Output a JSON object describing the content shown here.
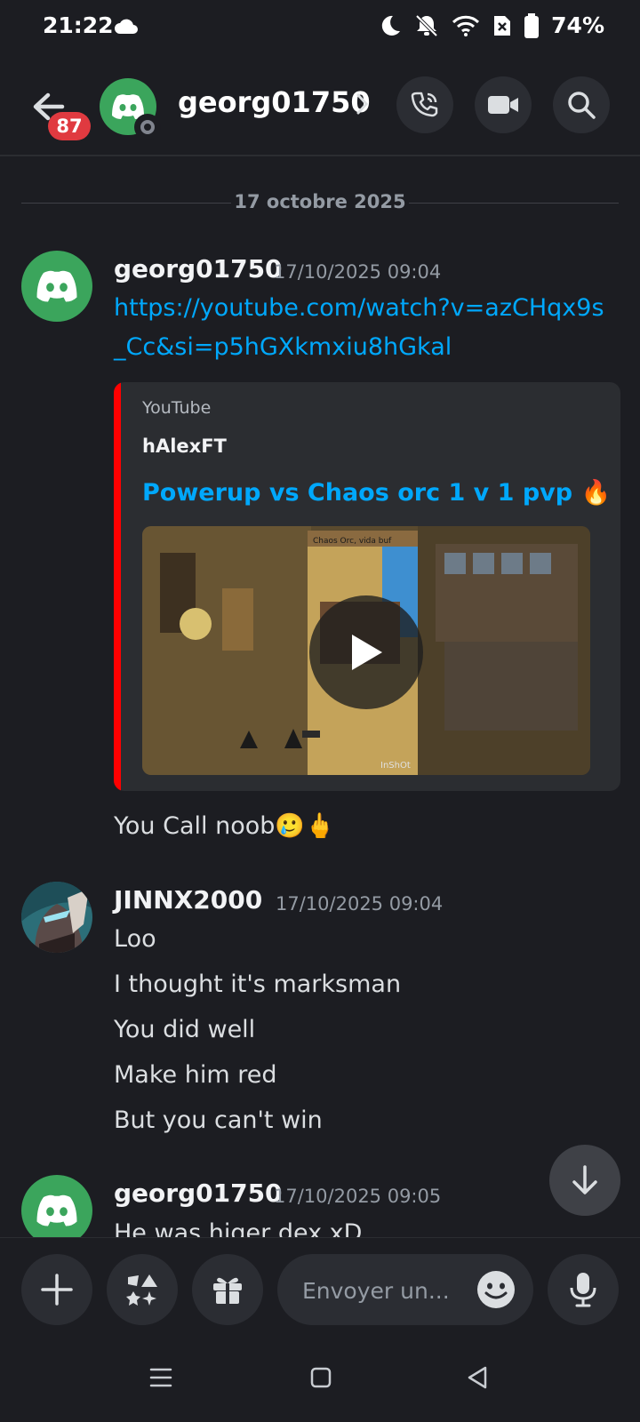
{
  "status_bar": {
    "time": "21:22",
    "battery": "74%"
  },
  "header": {
    "unread_count": "87",
    "username": "georg01750",
    "icons": [
      "back-arrow-icon",
      "call-icon",
      "video-icon",
      "search-icon"
    ]
  },
  "date_divider": "17 octobre 2025",
  "messages": [
    {
      "author": "georg01750",
      "timestamp": "17/10/2025 09:04",
      "link": "https://youtube.com/watch?v=azCHqx9s_Cc&si=p5hGXkmxiu8hGkal",
      "embed": {
        "provider": "YouTube",
        "author": "hAlexFT",
        "title": "Powerup vs Chaos orc 1 v 1 pvp 🔥",
        "thumb_caption": "Chaos Orc, vida buf",
        "thumb_watermark": "InShOt"
      },
      "text": "You Call noob🥲🖕"
    },
    {
      "author": "JINNX2000",
      "timestamp": "17/10/2025 09:04",
      "lines": [
        "Loo",
        "I thought it's marksman",
        "You did well",
        "Make him red",
        "But you can't win"
      ]
    },
    {
      "author": "georg01750",
      "timestamp": "17/10/2025 09:05",
      "text": "He was higer dex xD"
    }
  ],
  "composer": {
    "placeholder": "Envoyer un..."
  },
  "colors": {
    "background": "#1c1d22",
    "link": "#00a8fc",
    "embed_bar": "#ff0000",
    "badge": "#e03a40",
    "avatar": "#3ba55c"
  }
}
